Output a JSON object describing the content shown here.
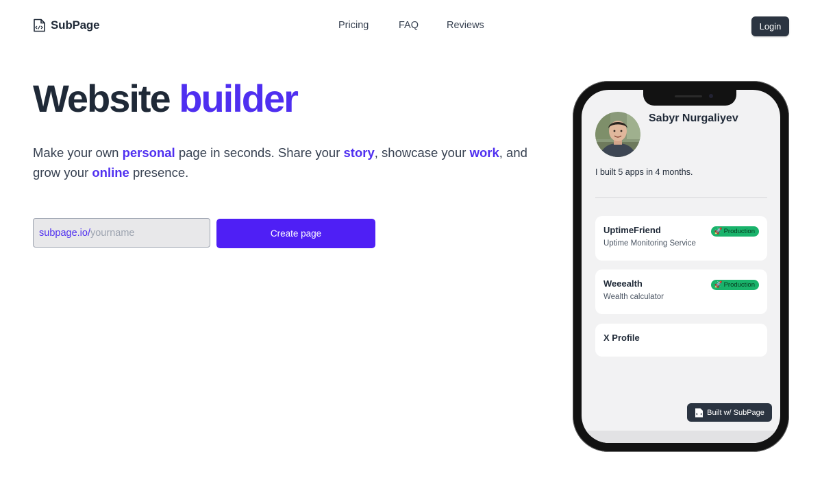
{
  "header": {
    "logo_text": "SubPage",
    "nav": [
      "Pricing",
      "FAQ",
      "Reviews"
    ],
    "login_label": "Login"
  },
  "hero": {
    "title_plain": "Website",
    "title_accent": "builder",
    "subtitle": {
      "t1": "Make your own ",
      "h1": "personal",
      "t2": " page in seconds. Share your ",
      "h2": "story",
      "t3": ", showcase your ",
      "h3": "work",
      "t4": ", and grow your ",
      "h4": "online",
      "t5": " presence."
    },
    "url_prefix": "subpage.io/",
    "url_placeholder": "yourname",
    "create_label": "Create page",
    "accent_color": "#4f2ff0"
  },
  "preview": {
    "name": "Sabyr Nurgaliyev",
    "bio": "I built 5 apps in 4 months.",
    "cards": [
      {
        "title": "UptimeFriend",
        "desc": "Uptime Monitoring Service",
        "badge": "Production"
      },
      {
        "title": "Weeealth",
        "desc": "Wealth calculator",
        "badge": "Production"
      },
      {
        "title": "X Profile",
        "desc": "",
        "badge": ""
      }
    ],
    "built_label": "Built w/ SubPage",
    "badge_color": "#19b36b"
  },
  "icons": {
    "logo": "code-file-icon",
    "badge": "rocket-icon"
  }
}
